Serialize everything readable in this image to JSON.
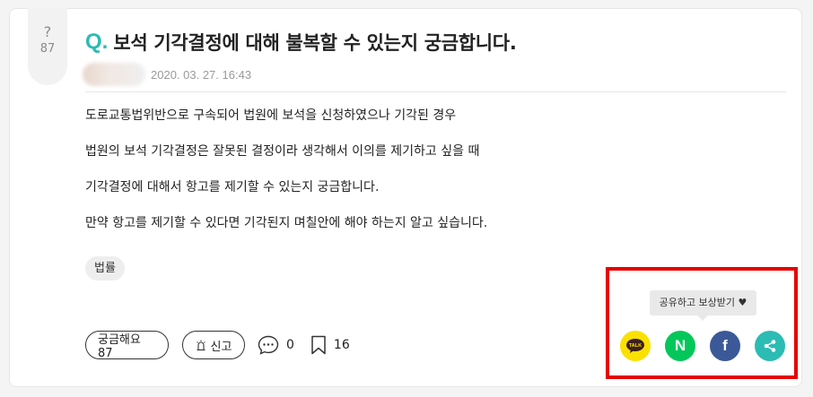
{
  "question_badge": {
    "mark": "?",
    "count": "87"
  },
  "title": {
    "prefix": "Q.",
    "text": "보석 기각결정에 대해 불복할 수 있는지 궁금합니다."
  },
  "meta": {
    "date": "2020. 03. 27. 16:43"
  },
  "body": [
    "도로교통법위반으로 구속되어 법원에 보석을 신청하였으나 기각된 경우",
    "법원의 보석 기각결정은 잘못된 결정이라 생각해서 이의를 제기하고 싶을 때",
    "기각결정에 대해서 항고를 제기할 수 있는지 궁금합니다.",
    "만약 항고를 제기할 수 있다면 기각된지 며칠안에 해야 하는지 알고 싶습니다."
  ],
  "tag": "법률",
  "actions": {
    "curious_label": "궁금해요 87",
    "report_label": "신고",
    "comments_count": "0",
    "bookmarks_count": "16"
  },
  "share": {
    "tooltip": "공유하고 보상받기 ♥",
    "kakao_text": "TALK",
    "naver_text": "N",
    "facebook_text": "f"
  },
  "colors": {
    "accent": "#2bbcb4",
    "kakao": "#fae100",
    "naver": "#03c75a",
    "facebook": "#3b5998",
    "highlight": "#e60000"
  }
}
